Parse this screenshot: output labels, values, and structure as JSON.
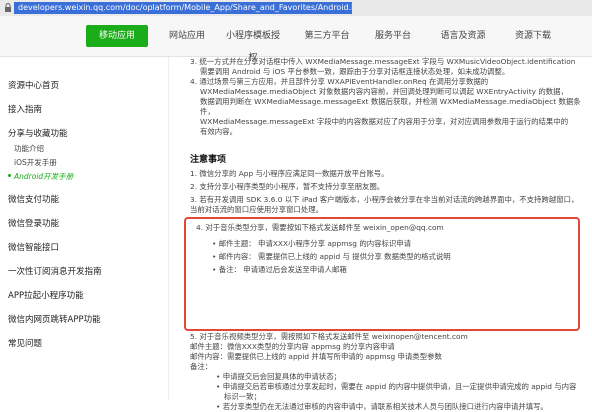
{
  "browser": {
    "url": "developers.weixin.qq.com/doc/oplatform/Mobile_App/Share_and_Favorites/Android.html"
  },
  "nav": {
    "tabs": [
      {
        "label": "移动应用",
        "active": true
      },
      {
        "label": "网站应用",
        "active": false
      },
      {
        "label": "小程序模板授权",
        "active": false
      },
      {
        "label": "第三方平台",
        "active": false
      },
      {
        "label": "服务平台",
        "active": false
      },
      {
        "label": "语言及资源",
        "active": false
      },
      {
        "label": "资源下载",
        "active": false
      }
    ]
  },
  "sidebar": {
    "items": [
      {
        "label": "资源中心首页",
        "sub": false
      },
      {
        "label": "接入指南",
        "sub": false
      },
      {
        "label": "分享与收藏功能",
        "sub": false
      },
      {
        "label": "功能介绍",
        "sub": true
      },
      {
        "label": "iOS开发手册",
        "sub": true
      },
      {
        "label": "Android开发手册",
        "sub": true,
        "active": true
      },
      {
        "label": "微信支付功能",
        "sub": false
      },
      {
        "label": "微信登录功能",
        "sub": false
      },
      {
        "label": "微信智能接口",
        "sub": false
      },
      {
        "label": "一次性订阅消息开发指南",
        "sub": false
      },
      {
        "label": "APP拉起小程序功能",
        "sub": false
      },
      {
        "label": "微信内网页跳转APP功能",
        "sub": false
      },
      {
        "label": "常见问题",
        "sub": false
      }
    ]
  },
  "main": {
    "top_paras": [
      "3. 统一方式并在分享对话框中传入 WXMediaMessage.messageExt 字段与 WXMusicVideoObject.identification",
      "需要调用 Android 与 iOS 平台参数一致，跟踪由于分享对话框连接状态处理，如未成功调整。",
      "4. 通过场景与第三方应用，并且部件分享 WXAPIEventHandler.onReq 在调用分享数据的",
      "WXMediaMessage.mediaObject 对象数据内容内容前，并回调处理判断可以调起 WXEntryActivity 的数据，",
      "数据调用判断在 WXMediaMessage.messageExt 数据后获取，并检测 WXMediaMessage.mediaObject 数据条件，",
      "WXMediaMessage.messageExt 字段中的内容数据对应了内容用于分享，对对应调用参数用于运行的结果中的",
      "有效内容。"
    ],
    "notice_heading": "注意事项",
    "notes": [
      "1. 微信分享的 App 与小程序应满足同一数据开放平台账号。",
      "2. 支持分享小程序类型的小程序，暂不支持分享至朋友圈。",
      "3. 若有开发调用 SDK 3.6.0 以下 iPad 客户端版本，小程序会被分享在非当前对话流的跨越界面中，不支持跨越窗口，",
      "   当前对话流的窗口应使用分享窗口处理。"
    ],
    "boxed": {
      "intro": "4. 对于音乐类型分享，需要按如下格式发送邮件至 weixin_open@qq.com",
      "items": [
        "邮件主题：",
        "邮件内容：",
        "备注："
      ],
      "details": [
        "申请XXX小程序分享 appmsg 的内容标识申请",
        "需要提供已上线的 appid 与 提供分享 数据类型的格式说明",
        "申请通过后会发送至申请人邮箱"
      ]
    },
    "after_box": [
      "5. 对于音乐视频类型分享，需按照如下格式发送邮件至 weixinopen@tencent.com",
      "     邮件主题：微信XXX类型的分享内容 appmsg 的分享内容申请",
      "     邮件内容：需要提供已上线的 appid 并填写所申请的 appmsg 申请类型参数",
      "     备注："
    ],
    "after_bullets": [
      "申请提交后会回复具体的申请状态；",
      "申请提交后若审核通过分享发起时，需要在 appid 的内容中提供申请，且一定提供申请完成的 appid 与内容",
      "标识一致；",
      "若分享类型仍在无法通过审核的内容申请中，请联系相关技术人员与团队接口进行内容申请并填写。"
    ]
  },
  "colors": {
    "accent": "#1aad19",
    "highlight_box": "#e0483a",
    "url_bg": "#3a6fd8"
  }
}
